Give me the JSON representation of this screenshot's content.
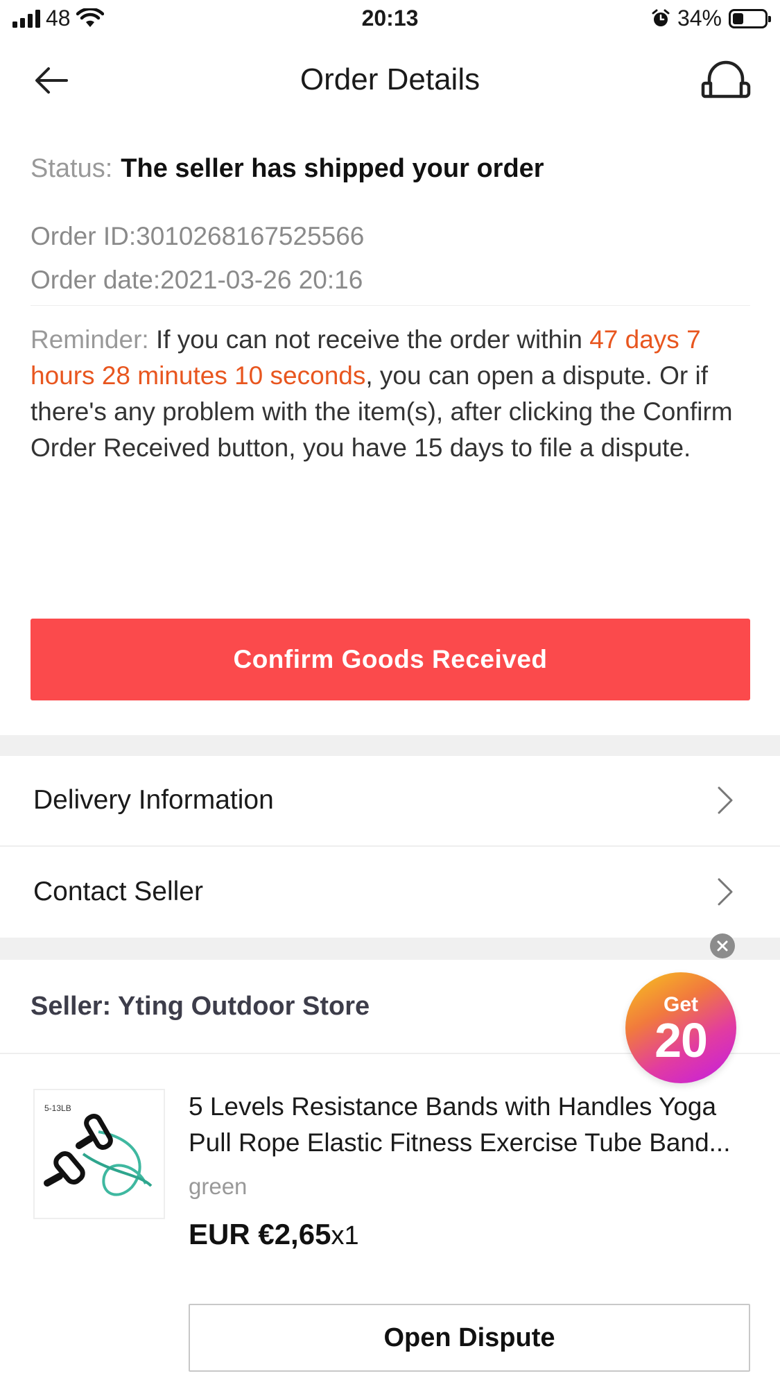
{
  "status_bar": {
    "carrier": "48",
    "time": "20:13",
    "battery_percent": "34%",
    "battery_level": 0.34,
    "icons": [
      "signal-icon",
      "wifi-icon",
      "alarm-icon",
      "battery-icon"
    ]
  },
  "nav": {
    "title": "Order Details",
    "back_icon": "arrow-left-icon",
    "support_icon": "headset-icon"
  },
  "order": {
    "status_label": "Status:",
    "status_text": "The seller has shipped your order",
    "order_id": "Order ID:3010268167525566",
    "order_date": "Order date:2021-03-26 20:16"
  },
  "reminder": {
    "label": "Reminder:",
    "text_before": "If you can not receive the order within",
    "countdown": "47 days 7 hours 28 minutes 10 seconds",
    "text_after": ", you can open a dispute. Or if there's any problem with the item(s), after clicking the Confirm Order Received button, you have 15 days to file a dispute."
  },
  "actions": {
    "confirm_label": "Confirm Goods Received",
    "dispute_label": "Open Dispute"
  },
  "rows": {
    "delivery": "Delivery Information",
    "contact": "Contact Seller"
  },
  "seller": {
    "name": "Seller: Yting Outdoor Store"
  },
  "promo": {
    "get": "Get",
    "amount": "20"
  },
  "product": {
    "title": "5 Levels Resistance Bands with Handles Yoga Pull Rope Elastic Fitness Exercise Tube Band...",
    "sku": "green",
    "price": "EUR €2,65",
    "qty": "x1",
    "image_caption": "5-13LB"
  },
  "colors": {
    "accent_red": "#fb4a4c",
    "highlight_orange": "#e8561f",
    "band_green": "#3fb8a0"
  }
}
